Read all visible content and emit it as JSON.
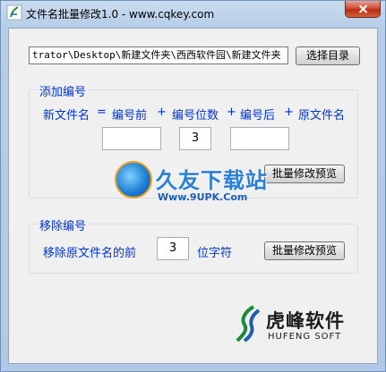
{
  "window": {
    "title": "文件名批量修改1.0 - www.cqkey.com"
  },
  "path": {
    "value": "trator\\Desktop\\新建文件夹\\西西软件园\\新建文件夹",
    "browse_label": "选择目录"
  },
  "add_group": {
    "title": "添加编号",
    "formula": {
      "new_name": "新文件名",
      "eq": "=",
      "prefix": "编号前",
      "plus1": "+",
      "digits": "编号位数",
      "plus2": "+",
      "suffix": "编号后",
      "plus3": "+",
      "original": "原文件名"
    },
    "prefix_value": "",
    "digits_value": "3",
    "suffix_value": "",
    "preview_label": "批量修改预览"
  },
  "remove_group": {
    "title": "移除编号",
    "label_before": "移除原文件名的前",
    "count_value": "3",
    "label_after": "位字符",
    "preview_label": "批量修改预览"
  },
  "watermark": {
    "title": "久友下载站",
    "url": "Www.9UPK.Com"
  },
  "brand": {
    "name": "虎峰软件",
    "name_en": "HUFENG SOFT"
  },
  "icons": {
    "app": "app-icon",
    "close": "close-icon"
  },
  "colors": {
    "accent": "#0033cc",
    "close_red": "#c8381a",
    "frame": "#b6cde7"
  }
}
